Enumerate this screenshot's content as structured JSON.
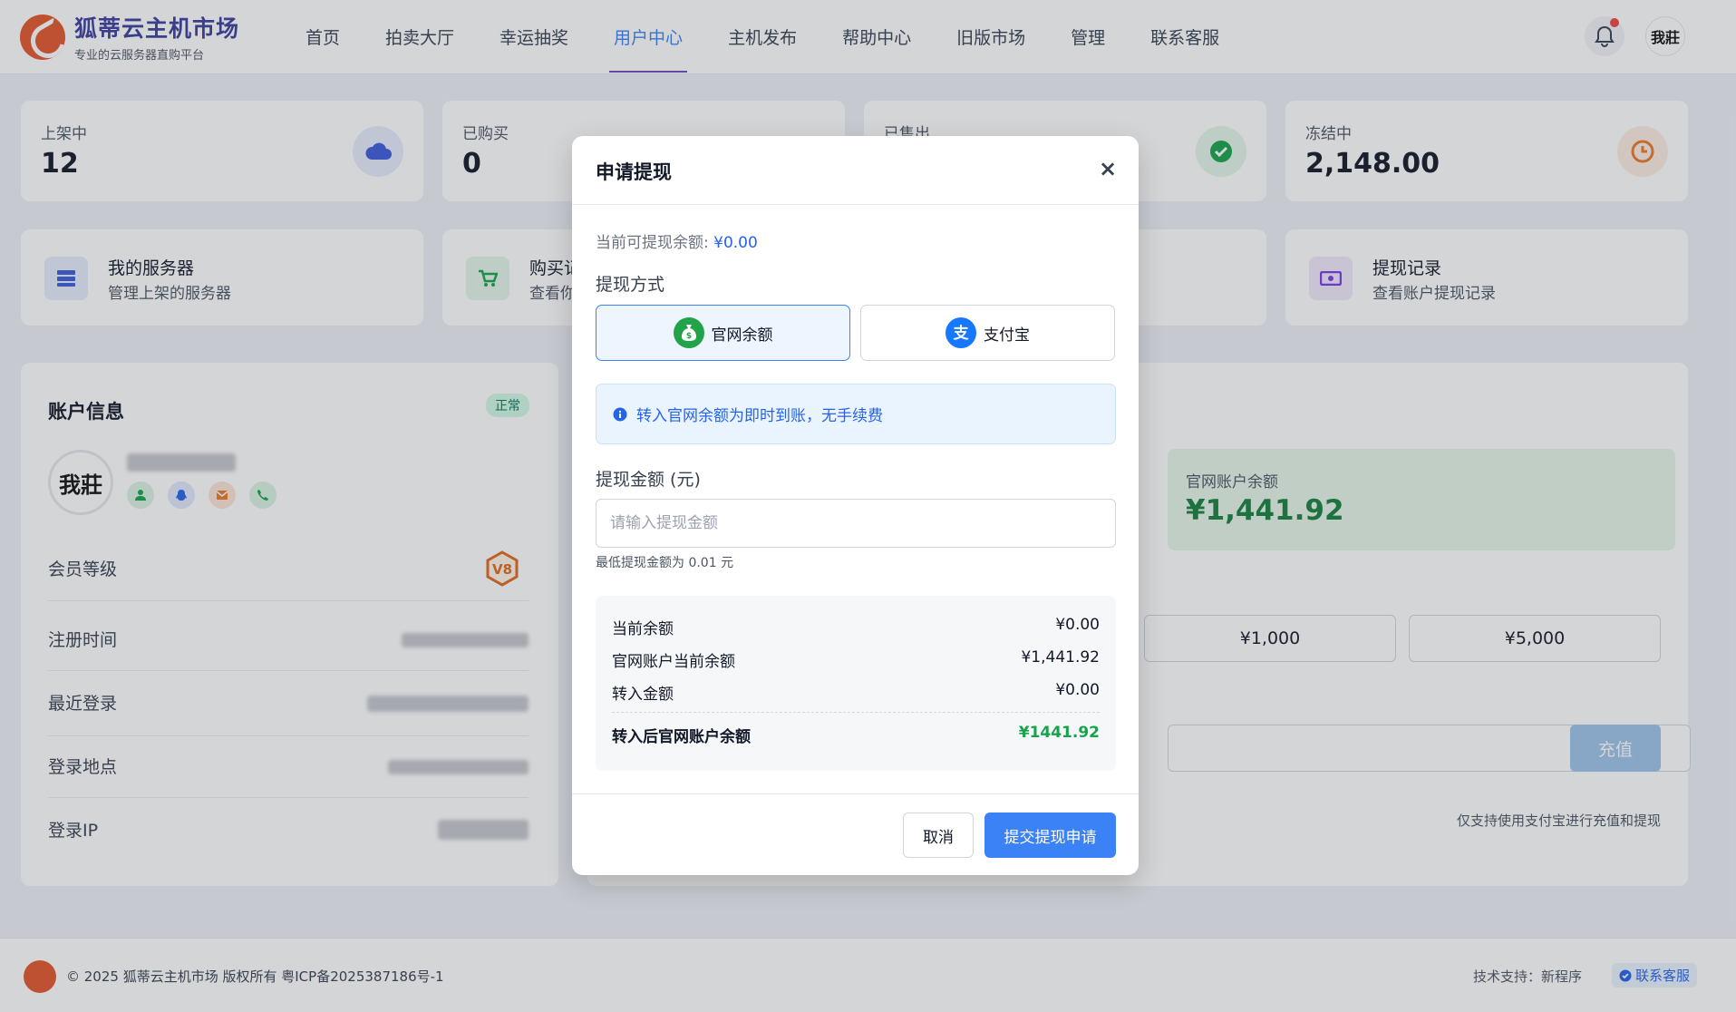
{
  "header": {
    "brand_name": "狐蒂云主机市场",
    "brand_sub": "专业的云服务器直购平台",
    "nav": [
      "首页",
      "拍卖大厅",
      "幸运抽奖",
      "用户中心",
      "主机发布",
      "帮助中心",
      "旧版市场",
      "管理",
      "联系客服"
    ],
    "active_nav": "用户中心",
    "avatar_text": "我莊"
  },
  "stats": [
    {
      "label": "上架中",
      "value": "12",
      "icon": "cloud-icon",
      "color": "#3b5bdb"
    },
    {
      "label": "已购买",
      "value": "0",
      "icon": "cart-icon",
      "color": "#9ca3af"
    },
    {
      "label": "已售出",
      "value": "",
      "icon": "check-circle-icon",
      "color": "#16a34a"
    },
    {
      "label": "冻结中",
      "value": "2,148.00",
      "icon": "clock-icon",
      "color": "#ea7a2b"
    }
  ],
  "quick_links": [
    {
      "title": "我的服务器",
      "sub": "管理上架的服务器",
      "icon": "server-icon",
      "color": "#3b5bdb"
    },
    {
      "title": "购买记",
      "sub": "查看你",
      "icon": "cart-icon",
      "color": "#16a34a"
    },
    {
      "title": "提现记录",
      "sub": "查看账户提现记录",
      "icon": "money-icon",
      "color": "#7c3aed"
    }
  ],
  "account": {
    "title": "账户信息",
    "status": "正常",
    "avatar_text": "我莊",
    "rows": [
      "会员等级",
      "注册时间",
      "最近登录",
      "登录地点",
      "登录IP"
    ],
    "vip_level": "V8"
  },
  "recharge": {
    "balance_label": "官网账户余额",
    "balance_value": "¥1,441.92",
    "amounts": [
      "¥1,000",
      "¥5,000"
    ],
    "button": "充值",
    "note": "仅支持使用支付宝进行充值和提现"
  },
  "footer": {
    "copyright": "© 2025 狐蒂云主机市场  版权所有  粤ICP备2025387186号-1",
    "tech": "技术支持：新程序",
    "service": "联系客服"
  },
  "modal": {
    "title": "申请提现",
    "close": "×",
    "available_label": "当前可提现余额: ",
    "available_value": "¥0.00",
    "method_label": "提现方式",
    "methods": [
      {
        "label": "官网余额",
        "icon": "money-bag-icon",
        "color": "#22a34a",
        "selected": true
      },
      {
        "label": "支付宝",
        "icon": "alipay-icon",
        "color": "#1677ff",
        "selected": false
      }
    ],
    "info": "转入官网余额为即时到账，无手续费",
    "amount_label": "提现金额 (元)",
    "amount_placeholder": "请输入提现金额",
    "amount_value": "",
    "min_note": "最低提现金额为 0.01 元",
    "summary": [
      {
        "label": "当前余额",
        "value": "¥0.00"
      },
      {
        "label": "官网账户当前余额",
        "value": "¥1,441.92"
      },
      {
        "label": "转入金额",
        "value": "¥0.00"
      }
    ],
    "total_label": "转入后官网账户余额",
    "total_value": "¥1441.92",
    "cancel": "取消",
    "submit": "提交提现申请"
  }
}
